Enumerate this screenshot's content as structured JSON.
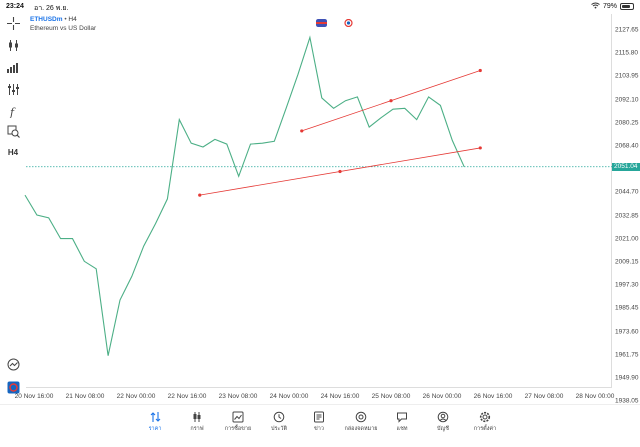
{
  "status": {
    "time": "23:24",
    "date": "อา. 26 พ.ย.",
    "battery": "79%",
    "battery_level": 0.79
  },
  "symbol": {
    "name": "ETHUSDm",
    "timeframe": "H4",
    "description": "Ethereum vs US Dollar"
  },
  "price_axis": {
    "labels": [
      "2127.65",
      "2115.80",
      "2103.95",
      "2092.10",
      "2080.25",
      "2068.40",
      "2056.55",
      "2044.70",
      "2032.85",
      "2021.00",
      "2009.15",
      "1997.30",
      "1985.45",
      "1973.60",
      "1961.75",
      "1949.90",
      "1938.05"
    ],
    "current": "2051.04"
  },
  "time_axis": {
    "labels": [
      "20 Nov 16:00",
      "21 Nov 08:00",
      "22 Nov 00:00",
      "22 Nov 16:00",
      "23 Nov 08:00",
      "24 Nov 00:00",
      "24 Nov 16:00",
      "25 Nov 08:00",
      "26 Nov 00:00",
      "26 Nov 16:00",
      "27 Nov 08:00",
      "28 Nov 00:00"
    ]
  },
  "toolbar": {
    "timeframe_label": "H4"
  },
  "tabs": [
    {
      "label": "ราคา",
      "icon": "sort-arrows-icon",
      "active": true
    },
    {
      "label": "กราฟ",
      "icon": "candlestick-icon",
      "active": false
    },
    {
      "label": "การซื้อขาย",
      "icon": "trade-chart-icon",
      "active": false
    },
    {
      "label": "ประวัติ",
      "icon": "history-icon",
      "active": false
    },
    {
      "label": "ข่าว",
      "icon": "news-icon",
      "active": false
    },
    {
      "label": "กล่องจดหมาย",
      "icon": "at-icon",
      "active": false
    },
    {
      "label": "แชท",
      "icon": "chat-icon",
      "active": false
    },
    {
      "label": "บัญชี",
      "icon": "account-icon",
      "active": false
    },
    {
      "label": "การตั้งค่า",
      "icon": "gear-icon",
      "active": false
    }
  ],
  "colors": {
    "line": "#4caf86",
    "trendline": "#e53935",
    "current_price": "#26a69a",
    "accent": "#1a73e8"
  },
  "chart_data": {
    "type": "line",
    "series": [
      {
        "values": [
          2036.0,
          2025.5,
          2024.0,
          2013.0,
          2013.0,
          2001.0,
          1997.0,
          1951.0,
          1980.5,
          1993.0,
          2009.0,
          2021.0,
          2034.0,
          2076.0,
          2063.5,
          2061.5,
          2065.5,
          2063.0,
          2046.0,
          2063.0,
          2063.5,
          2064.5,
          2082.0,
          2100.0,
          2119.5,
          2087.5,
          2082.0,
          2086.0,
          2088.0,
          2072.0,
          2077.0,
          2081.5,
          2082.0,
          2076.0,
          2088.0,
          2083.5,
          2065.0,
          2051.0
        ]
      }
    ],
    "trendlines": [
      {
        "start": {
          "x": "24 Nov 04:00",
          "y": 2070.0
        },
        "end": {
          "x": "26 Nov 12:00",
          "y": 2102.0
        },
        "mid": {
          "x": "25 Nov 08:00",
          "y": 2086.0
        }
      },
      {
        "start": {
          "x": "22 Nov 20:00",
          "y": 2036.0
        },
        "end": {
          "x": "26 Nov 12:00",
          "y": 2061.0
        },
        "mid": {
          "x": "24 Nov 16:00",
          "y": 2048.5
        }
      }
    ],
    "current_price": 2051.04,
    "ylim": [
      1933.9,
      2131.9
    ]
  }
}
